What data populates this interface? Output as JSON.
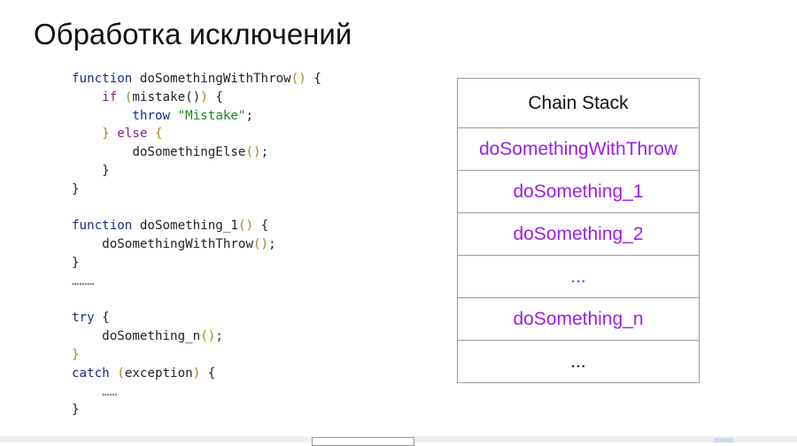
{
  "title": "Обработка исключений",
  "code": {
    "l1": [
      "function",
      "doSomethingWithThrow",
      "()",
      "{"
    ],
    "l2": [
      "if",
      "(",
      "mistake()",
      ")",
      "{"
    ],
    "l3": [
      "throw",
      "\"Mistake\"",
      ";"
    ],
    "l4": [
      "}",
      "else",
      "{"
    ],
    "l5": [
      "doSomethingElse",
      "()",
      ";"
    ],
    "l6": "}",
    "l7": "}",
    "l9": [
      "function",
      "doSomething_1",
      "()",
      "{"
    ],
    "l10": [
      "doSomethingWithThrow",
      "()",
      ";"
    ],
    "l11": "}",
    "l12": "………",
    "l14": [
      "try",
      "{"
    ],
    "l15": [
      "doSomething_n",
      "()",
      ";"
    ],
    "l16": "}",
    "l17": [
      "catch",
      "(",
      "exception",
      ")",
      "{"
    ],
    "l18": "……",
    "l19": "}"
  },
  "stack": {
    "header": "Chain Stack",
    "items": [
      "doSomethingWithThrow",
      "doSomething_1",
      "doSomething_2",
      "...",
      "doSomething_n",
      "..."
    ]
  }
}
